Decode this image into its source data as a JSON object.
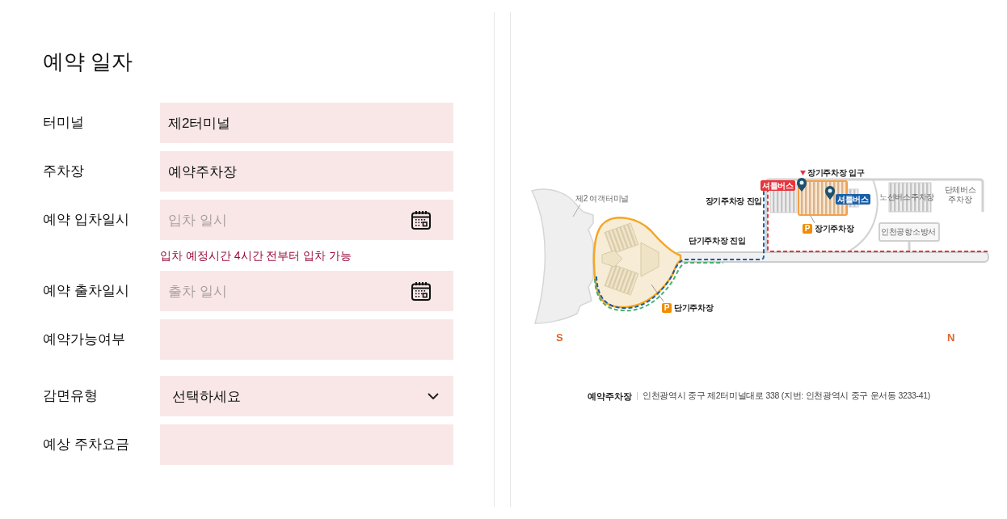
{
  "form": {
    "title": "예약 일자",
    "groups": [
      {
        "fields": [
          {
            "kind": "text",
            "label": "터미널",
            "value": "제2터미널"
          },
          {
            "kind": "text",
            "label": "주차장",
            "value": "예약주차장"
          },
          {
            "kind": "date",
            "label": "예약 입차일시",
            "placeholder": "입차 일시",
            "hint": "입차 예정시간 4시간 전부터 입차 가능"
          },
          {
            "kind": "date",
            "label": "예약 출차일시",
            "placeholder": "출차 일시"
          },
          {
            "kind": "text",
            "label": "예약가능여부"
          }
        ]
      },
      {
        "fields": [
          {
            "kind": "select",
            "label": "감면유형",
            "value": "선택하세요"
          },
          {
            "kind": "text",
            "label": "예상 주차요금"
          }
        ]
      }
    ]
  },
  "map": {
    "labels": [
      {
        "kind": "entrance",
        "text": "장기주차장 입구"
      },
      {
        "kind": "place",
        "text": "제2 여객터미널"
      },
      {
        "kind": "road",
        "text": "장기주차장 진입"
      },
      {
        "kind": "shuttle",
        "text": "셔틀버스",
        "color": "#e8343c"
      },
      {
        "kind": "shuttle",
        "text": "셔틀버스",
        "color": "#1a5fa8"
      },
      {
        "kind": "place",
        "text": "노선버스주차장"
      },
      {
        "kind": "place",
        "text": "단체버스 주차장"
      },
      {
        "kind": "parking",
        "sign": "P",
        "text": "장기주차장"
      },
      {
        "kind": "place",
        "text": "인천공항소방서"
      },
      {
        "kind": "road",
        "text": "단기주차장 진입"
      },
      {
        "kind": "parking",
        "sign": "P",
        "text": "단기주차장"
      }
    ],
    "compass": [
      {
        "text": "S"
      },
      {
        "text": "N"
      }
    ]
  },
  "location": {
    "name": "예약주차장",
    "address": "인천광역시 중구 제2터미널대로 338 (지번: 인천광역시 중구 운서동 3233-41)"
  }
}
